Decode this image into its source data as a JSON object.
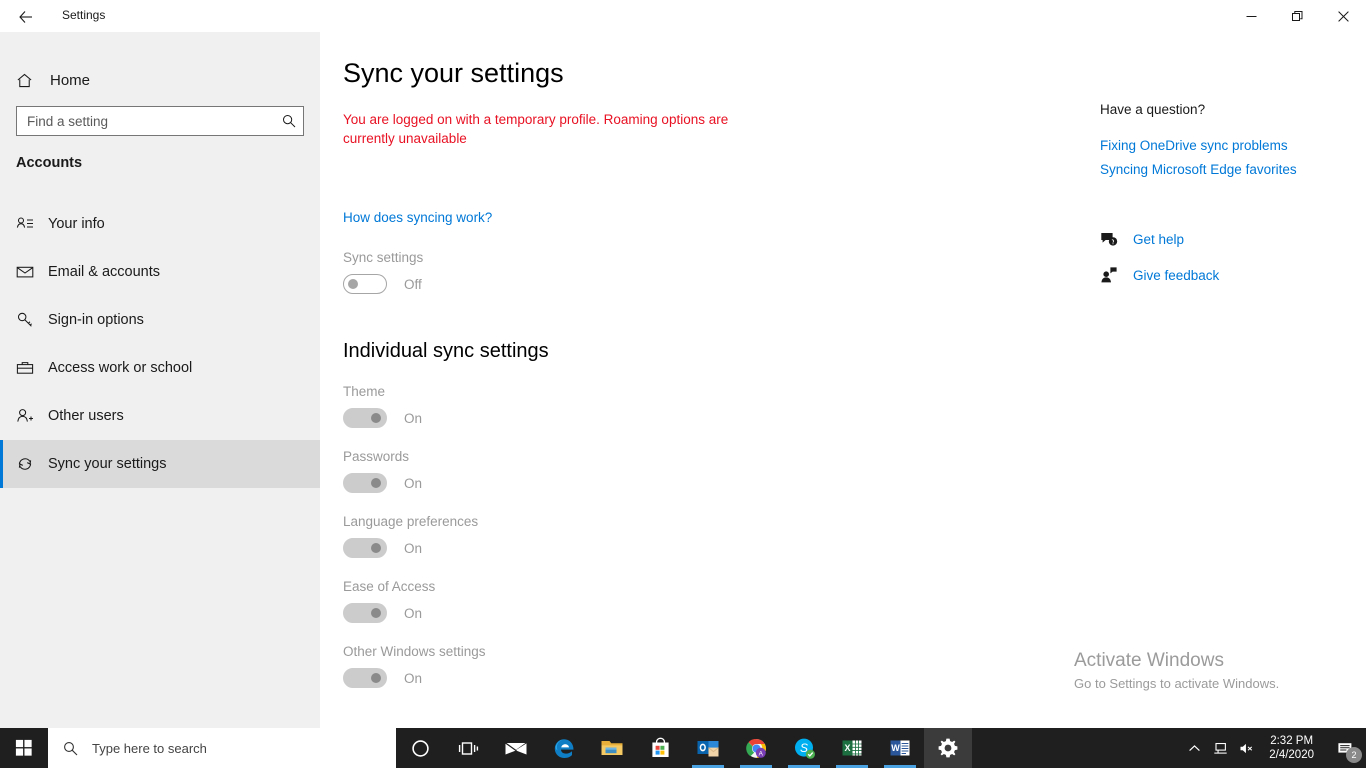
{
  "window": {
    "app_title": "Settings",
    "back_icon": "back-arrow-icon",
    "minimize_label": "Minimize",
    "restore_label": "Restore",
    "close_label": "Close"
  },
  "sidebar": {
    "home_label": "Home",
    "home_icon": "home-icon",
    "search": {
      "placeholder": "Find a setting",
      "value": "",
      "icon": "search-icon"
    },
    "category": "Accounts",
    "items": [
      {
        "label": "Your info",
        "icon": "user-info-icon",
        "selected": false
      },
      {
        "label": "Email & accounts",
        "icon": "envelope-icon",
        "selected": false
      },
      {
        "label": "Sign-in options",
        "icon": "key-icon",
        "selected": false
      },
      {
        "label": "Access work or school",
        "icon": "briefcase-icon",
        "selected": false
      },
      {
        "label": "Other users",
        "icon": "add-user-icon",
        "selected": false
      },
      {
        "label": "Sync your settings",
        "icon": "sync-icon",
        "selected": true
      }
    ],
    "accent_color": "#0078d7",
    "selected_bg": "#dadada",
    "background": "#f0f0f0"
  },
  "main": {
    "page_title": "Sync your settings",
    "warning_text": "You are logged on with a temporary profile. Roaming options are currently unavailable",
    "warning_color": "#e81123",
    "how_link": "How does syncing work?",
    "link_color": "#0078d7",
    "master_toggle": {
      "label": "Sync settings",
      "state": "Off"
    },
    "individual_title": "Individual sync settings",
    "individual_toggles": [
      {
        "label": "Theme",
        "state": "On"
      },
      {
        "label": "Passwords",
        "state": "On"
      },
      {
        "label": "Language preferences",
        "state": "On"
      },
      {
        "label": "Ease of Access",
        "state": "On"
      },
      {
        "label": "Other Windows settings",
        "state": "On"
      }
    ]
  },
  "help": {
    "heading": "Have a question?",
    "links": [
      "Fixing OneDrive sync problems",
      "Syncing Microsoft Edge favorites"
    ],
    "actions": [
      {
        "label": "Get help",
        "icon": "help-bubble-icon"
      },
      {
        "label": "Give feedback",
        "icon": "feedback-person-icon"
      }
    ]
  },
  "watermark": {
    "line1": "Activate Windows",
    "line2": "Go to Settings to activate Windows."
  },
  "taskbar": {
    "start_icon": "windows-start-icon",
    "search_placeholder": "Type here to search",
    "search_icon": "search-icon",
    "apps": [
      {
        "name": "cortana-icon",
        "active": false,
        "running": false
      },
      {
        "name": "task-view-icon",
        "active": false,
        "running": false
      },
      {
        "name": "mail-icon",
        "active": false,
        "running": false
      },
      {
        "name": "edge-icon",
        "active": false,
        "running": false
      },
      {
        "name": "file-explorer-icon",
        "active": false,
        "running": false
      },
      {
        "name": "microsoft-store-icon",
        "active": false,
        "running": false
      },
      {
        "name": "outlook-icon",
        "active": false,
        "running": true
      },
      {
        "name": "chrome-icon",
        "active": false,
        "running": true
      },
      {
        "name": "skype-icon",
        "active": false,
        "running": true
      },
      {
        "name": "excel-icon",
        "active": false,
        "running": true
      },
      {
        "name": "word-icon",
        "active": false,
        "running": true
      },
      {
        "name": "settings-gear-icon",
        "active": true,
        "running": true
      }
    ],
    "tray": {
      "chevron_icon": "chevron-up-icon",
      "network_icon": "network-icon",
      "volume_icon": "volume-muted-icon",
      "time": "2:32 PM",
      "date": "2/4/2020",
      "notification_icon": "notification-icon",
      "notification_count": "2"
    }
  }
}
